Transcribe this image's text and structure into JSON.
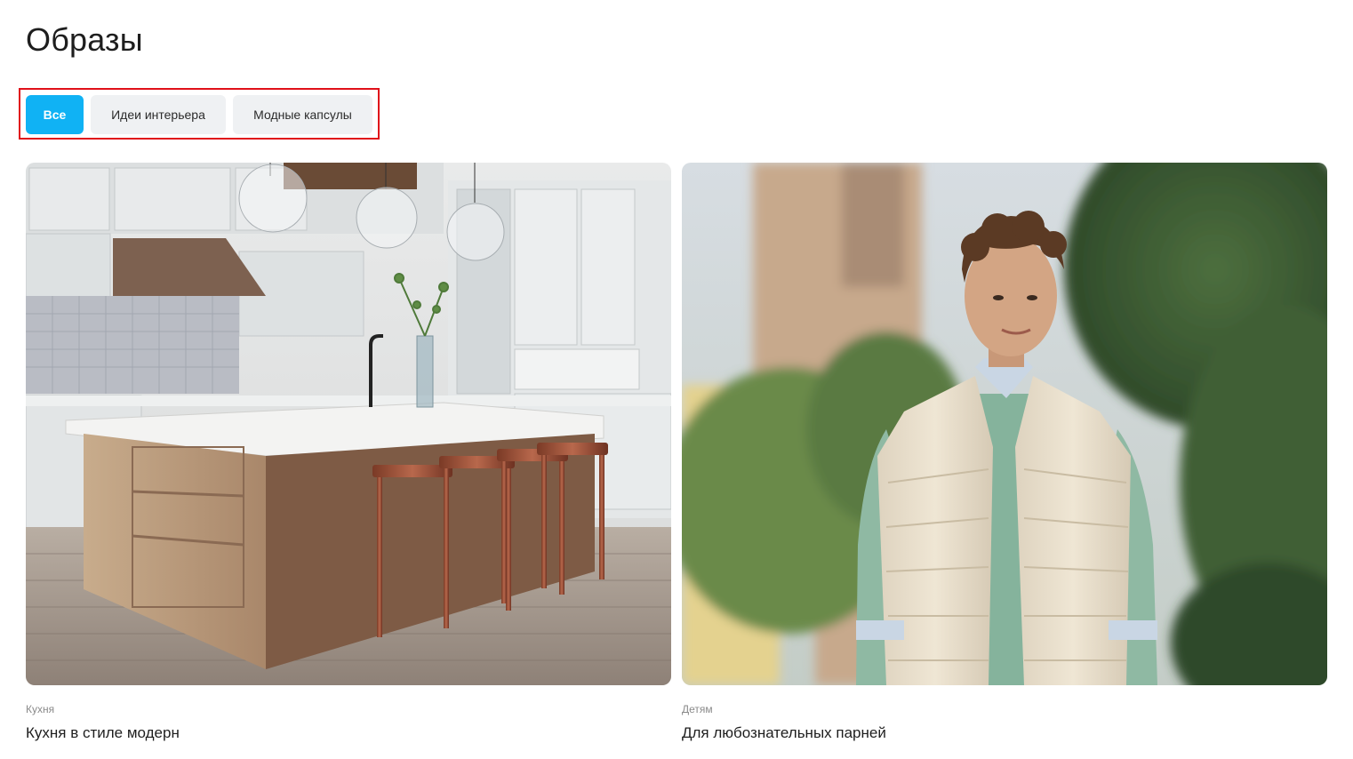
{
  "page": {
    "title": "Образы"
  },
  "filters": [
    {
      "label": "Все",
      "active": true
    },
    {
      "label": "Идеи интерьера",
      "active": false
    },
    {
      "label": "Модные капсулы",
      "active": false
    }
  ],
  "cards": [
    {
      "category": "Кухня",
      "title": "Кухня в стиле модерн",
      "image": "kitchen-interior-photo"
    },
    {
      "category": "Детям",
      "title": "Для любознательных парней",
      "image": "teen-boy-in-vest-photo"
    }
  ],
  "colors": {
    "accent": "#10b2f4",
    "chip_bg": "#eff1f3",
    "highlight_border": "#e0111a"
  }
}
